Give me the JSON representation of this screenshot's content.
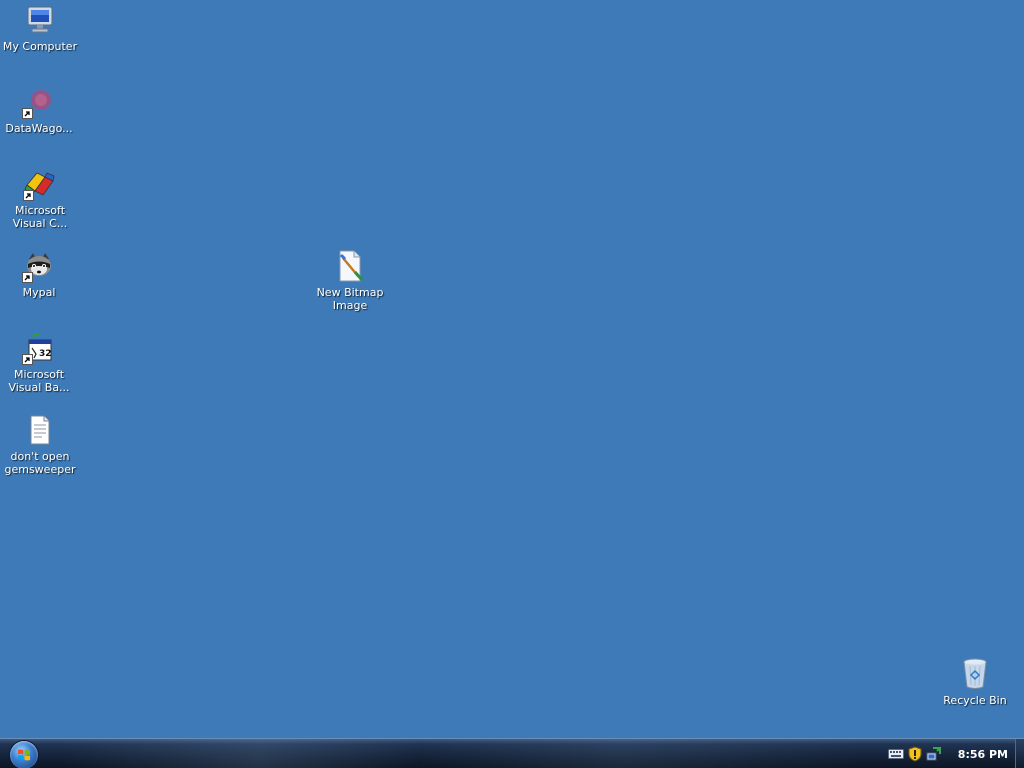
{
  "desktop": {
    "background": "#3d7ab7",
    "icons": [
      {
        "id": "my-computer",
        "label": "My Computer",
        "icon": "computer-icon"
      },
      {
        "id": "datawagon",
        "label": "DataWago...",
        "icon": "datawagon-icon",
        "shortcut": true
      },
      {
        "id": "ms-visual-c",
        "label": "Microsoft\nVisual C...",
        "icon": "visual-cpp-icon",
        "shortcut": true
      },
      {
        "id": "mypal",
        "label": "Mypal",
        "icon": "mypal-raccoon-icon",
        "shortcut": true
      },
      {
        "id": "ms-visual-ba",
        "label": "Microsoft\nVisual Ba...",
        "icon": "visual-basic-icon",
        "shortcut": true
      },
      {
        "id": "dont-open",
        "label": "don't open\ngemsweeper",
        "icon": "text-document-icon"
      },
      {
        "id": "new-bitmap",
        "label": "New Bitmap\nImage",
        "icon": "bitmap-image-icon"
      },
      {
        "id": "recycle-bin",
        "label": "Recycle Bin",
        "icon": "recycle-bin-icon"
      }
    ]
  },
  "taskbar": {
    "start_icon": "windows-start-orb-icon",
    "tray_icons": [
      "keyboard-icon",
      "security-shield-icon",
      "network-icon"
    ],
    "clock": "8:56 PM"
  }
}
